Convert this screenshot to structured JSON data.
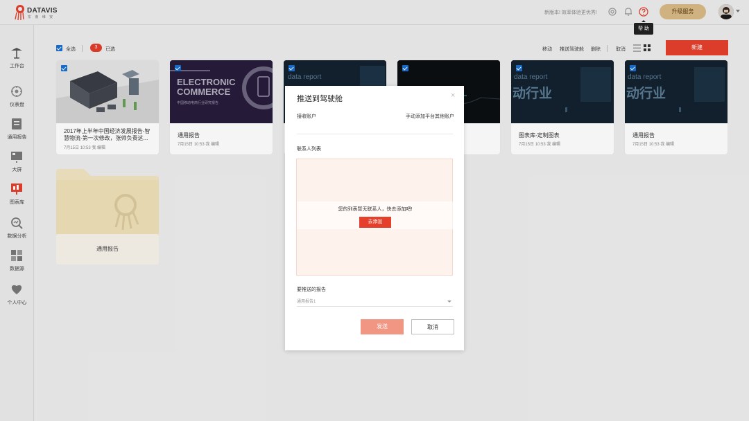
{
  "header": {
    "logo_text": "DATAVIS",
    "logo_sub": "东 南 维 安",
    "notice": "新版本! 效率体验更优秀!",
    "help_tooltip": "帮 助",
    "upgrade_label": "升级服务"
  },
  "sidebar": {
    "items": [
      {
        "label": "工作台",
        "icon": "workbench-icon"
      },
      {
        "label": "仪表盘",
        "icon": "dashboard-icon"
      },
      {
        "label": "通用报告",
        "icon": "report-icon"
      },
      {
        "label": "大屏",
        "icon": "screen-icon"
      },
      {
        "label": "图表库",
        "icon": "chart-library-icon"
      },
      {
        "label": "数据分析",
        "icon": "analysis-icon"
      },
      {
        "label": "数据源",
        "icon": "datasource-icon"
      },
      {
        "label": "个人中心",
        "icon": "profile-icon"
      }
    ]
  },
  "toolbar": {
    "select_all": "全选",
    "selected_count": "3",
    "selected_label": "已选",
    "move": "移动",
    "push": "推送驾驶舱",
    "delete": "删除",
    "cancel": "取消",
    "new": "新建"
  },
  "cards": [
    {
      "title": "2017年上半年中国经济发展报告-智慧物流-第一次修改，张帅负责这...",
      "date": "7月15日",
      "time": "10:53",
      "action": "我 编辑",
      "thumb_text": ""
    },
    {
      "title": "通用报告",
      "date": "7月15日",
      "time": "10:53",
      "action": "我 编辑",
      "thumb_text": "ELECTRONIC COMMERCE"
    },
    {
      "title": "",
      "date": "",
      "time": "",
      "action": "",
      "thumb_text": "data report"
    },
    {
      "title": "",
      "date": "",
      "time": "",
      "action": "",
      "thumb_text": ""
    },
    {
      "title": "图表库-定制图表",
      "date": "7月15日",
      "time": "10:53",
      "action": "我 编辑",
      "thumb_text": "data report"
    },
    {
      "title": "通用报告",
      "date": "7月15日",
      "time": "10:53",
      "action": "我 编辑",
      "thumb_text": "data report"
    }
  ],
  "card_thumb_extra": {
    "line2": "中国移动电商行业研究报告",
    "big": "动行业"
  },
  "folder": {
    "label": "通用报告"
  },
  "modal": {
    "title": "推送到驾驶舱",
    "close": "×",
    "receive_account": "接收账户",
    "add_account_link": "手动添加平台其他账户",
    "contacts_list": "联系人列表",
    "empty_message": "您的列表暂无联系人，快去添加吧!",
    "add_button": "去添加",
    "report_label": "要推送的报告",
    "report_value": "通用报告1",
    "send": "发送",
    "cancel": "取消"
  },
  "colors": {
    "accent_red": "#e5402c",
    "badge_red": "#e33d2a",
    "upgrade_gold": "#d9ba87",
    "checkbox_blue": "#1a6fd1",
    "send_pink": "#f29684"
  }
}
